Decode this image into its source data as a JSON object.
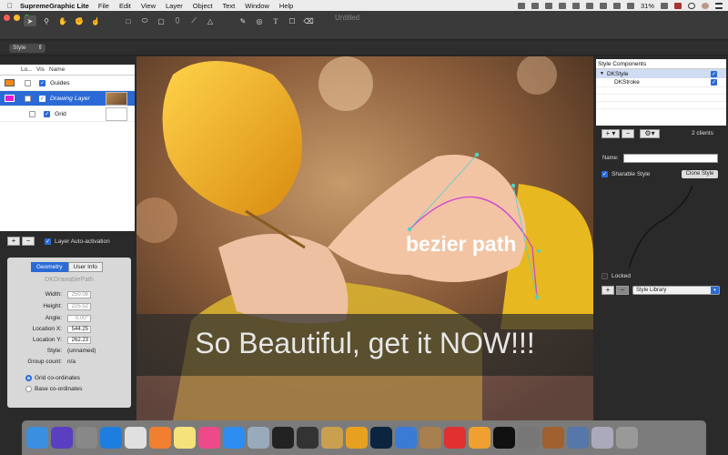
{
  "menubar": {
    "app_name": "SupremeGraphic Lite",
    "items": [
      "File",
      "Edit",
      "View",
      "Layer",
      "Object",
      "Text",
      "Window",
      "Help"
    ],
    "battery": "31%"
  },
  "window": {
    "title": "Untitled"
  },
  "stylebar": {
    "style_label": "Style"
  },
  "layers": {
    "headers": [
      "Lo...",
      "Vis",
      "Name"
    ],
    "rows": [
      {
        "name": "Guides",
        "color": "#f08a1c",
        "visible": true,
        "locked": false
      },
      {
        "name": "Drawing Layer",
        "color": "#e01bd0",
        "visible": true,
        "locked": false,
        "selected": true
      },
      {
        "name": "Grid",
        "color": "",
        "visible": true,
        "locked": false
      }
    ],
    "auto_activation_label": "Layer Auto-activation",
    "auto_activation_checked": true
  },
  "geometry": {
    "tabs": [
      "Geometry",
      "User Info"
    ],
    "object_class": "DKDrawablePath",
    "fields": [
      {
        "label": "Width:",
        "value": "250.08"
      },
      {
        "label": "Height:",
        "value": "225.52"
      },
      {
        "label": "Angle:",
        "value": "0.00°"
      },
      {
        "label": "Location X:",
        "value": "544.25"
      },
      {
        "label": "Location Y:",
        "value": "262.23"
      }
    ],
    "style_label": "Style:",
    "style_value": "(unnamed)",
    "group_label": "Group count:",
    "group_value": "n/a",
    "coord_options": [
      "Grid co-ordinates",
      "Base co-ordinates"
    ],
    "coord_selected": 0
  },
  "canvas": {
    "path_label": "bezier path",
    "banner_text": "So Beautiful, get it NOW!!!"
  },
  "style_components": {
    "title": "Style Components",
    "items": [
      {
        "name": "DKStyle",
        "checked": true,
        "selected": true
      },
      {
        "name": "DKStroke",
        "checked": true,
        "selected": false
      }
    ],
    "clients": "2  clients",
    "name_label": "Name:",
    "name_value": "",
    "sharable_label": "Sharable Style",
    "sharable_checked": true,
    "clone_label": "Clone Style",
    "locked_label": "Locked",
    "library_label": "Style Library"
  },
  "dock": {
    "apps": [
      {
        "name": "finder",
        "color": "#3b8fe0"
      },
      {
        "name": "siri",
        "color": "#5a3fc0"
      },
      {
        "name": "launchpad",
        "color": "#888"
      },
      {
        "name": "safari",
        "color": "#1e7ee0"
      },
      {
        "name": "chrome",
        "color": "#e0e0e0"
      },
      {
        "name": "firefox",
        "color": "#f08030"
      },
      {
        "name": "notes",
        "color": "#f5e27a"
      },
      {
        "name": "itunes",
        "color": "#ee4a8a"
      },
      {
        "name": "app-store",
        "color": "#2d8cf0"
      },
      {
        "name": "preview",
        "color": "#9ab"
      },
      {
        "name": "kindle",
        "color": "#222"
      },
      {
        "name": "qq",
        "color": "#333"
      },
      {
        "name": "painter",
        "color": "#c8a050"
      },
      {
        "name": "sketch",
        "color": "#e8a020"
      },
      {
        "name": "photoshop",
        "color": "#0b2540"
      },
      {
        "name": "xcode",
        "color": "#3a7bd5"
      },
      {
        "name": "scrivener",
        "color": "#a88050"
      },
      {
        "name": "player",
        "color": "#e03030"
      },
      {
        "name": "photos",
        "color": "#f0a030"
      },
      {
        "name": "terminal",
        "color": "#111"
      },
      {
        "name": "system-preferences",
        "color": "#777"
      },
      {
        "name": "supremegraphic",
        "color": "#a06030"
      },
      {
        "name": "photo-viewer",
        "color": "#5577aa"
      },
      {
        "name": "downloads",
        "color": "#aab"
      },
      {
        "name": "trash",
        "color": "#999"
      }
    ]
  }
}
